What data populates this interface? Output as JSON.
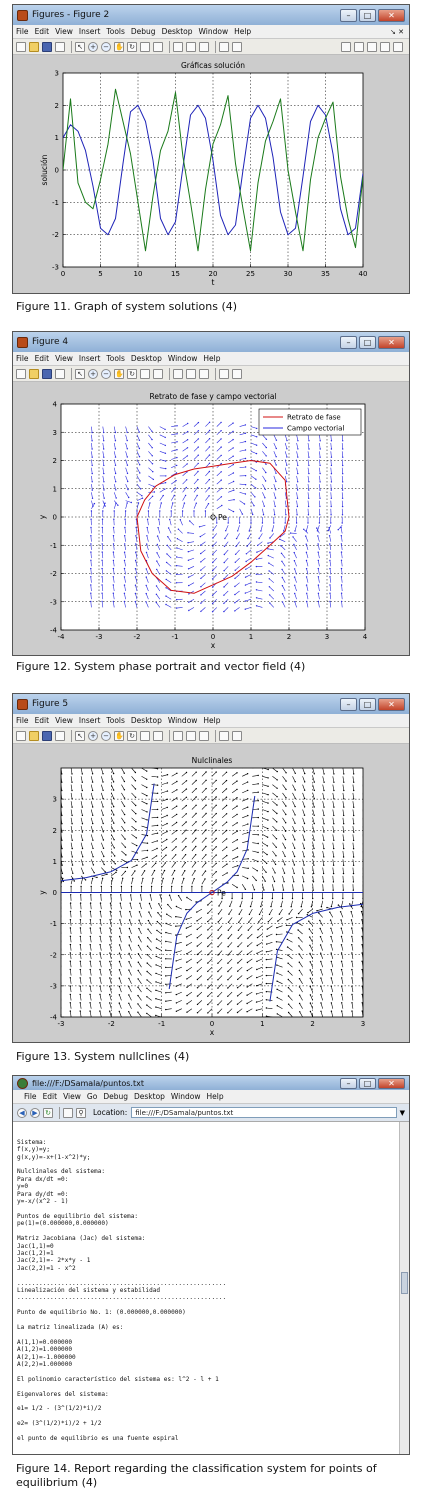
{
  "fig11": {
    "window_title": "Figures - Figure 2",
    "menu": [
      "File",
      "Edit",
      "View",
      "Insert",
      "Tools",
      "Debug",
      "Desktop",
      "Window",
      "Help"
    ],
    "menu_right": "↘ ✕",
    "caption": "Figure 11. Graph of system solutions (4)",
    "chart_data": {
      "type": "line",
      "title": "Gráficas solución",
      "xlabel": "t",
      "ylabel": "solución",
      "xlim": [
        0,
        40
      ],
      "ylim": [
        -3,
        3
      ],
      "xticks": [
        "0",
        "5",
        "10",
        "15",
        "20",
        "25",
        "30",
        "35",
        "40"
      ],
      "yticks": [
        "-3",
        "-2",
        "-1",
        "0",
        "1",
        "2",
        "3"
      ],
      "grid": true,
      "series": [
        {
          "color": "#1f24b8",
          "x": [
            0,
            1,
            2,
            3,
            4,
            5,
            6,
            7,
            8,
            9,
            10,
            11,
            12,
            13,
            14,
            15,
            16,
            17,
            18,
            19,
            20,
            21,
            22,
            23,
            24,
            25,
            26,
            27,
            28,
            29,
            30,
            31,
            32,
            33,
            34,
            35,
            36,
            37,
            38,
            39,
            40
          ],
          "y": [
            1,
            1.4,
            1.2,
            0.6,
            -0.5,
            -1.8,
            -2.0,
            -1.5,
            0.2,
            1.8,
            2.0,
            1.5,
            0.3,
            -1.5,
            -2.0,
            -1.6,
            0.1,
            1.7,
            2.0,
            1.6,
            0.3,
            -1.4,
            -2.0,
            -1.7,
            0.0,
            1.6,
            2.0,
            1.6,
            0.4,
            -1.3,
            -2.0,
            -1.8,
            -0.2,
            1.5,
            2.0,
            1.7,
            0.5,
            -1.2,
            -2.0,
            -1.8,
            -0.1
          ]
        },
        {
          "color": "#1a7a1a",
          "x": [
            0,
            1,
            2,
            3,
            4,
            5,
            6,
            7,
            8,
            9,
            10,
            11,
            12,
            13,
            14,
            15,
            16,
            17,
            18,
            19,
            20,
            21,
            22,
            23,
            24,
            25,
            26,
            27,
            28,
            29,
            30,
            31,
            32,
            33,
            34,
            35,
            36,
            37,
            38,
            39,
            40
          ],
          "y": [
            0,
            2.2,
            -0.4,
            -1.0,
            -1.2,
            -0.3,
            0.8,
            2.5,
            1.5,
            0.5,
            -1.0,
            -2.5,
            -0.8,
            0.6,
            1.2,
            2.4,
            0.4,
            -1.0,
            -2.5,
            -0.6,
            0.8,
            1.4,
            2.3,
            0.2,
            -1.2,
            -2.5,
            -0.4,
            0.9,
            1.5,
            2.2,
            0.0,
            -1.3,
            -2.5,
            -0.3,
            1.0,
            1.6,
            2.1,
            -0.2,
            -1.5,
            -2.4,
            -0.2
          ]
        }
      ]
    }
  },
  "fig12": {
    "window_title": "Figure 4",
    "menu": [
      "File",
      "Edit",
      "View",
      "Insert",
      "Tools",
      "Desktop",
      "Window",
      "Help"
    ],
    "caption": "Figure 12. System phase portrait and vector field (4)",
    "chart_data": {
      "type": "line",
      "title": "Retrato de fase y campo vectorial",
      "xlabel": "x",
      "ylabel": "y",
      "xlim": [
        -4,
        4
      ],
      "ylim": [
        -4,
        4
      ],
      "xticks": [
        "-4",
        "-3",
        "-2",
        "-1",
        "0",
        "1",
        "2",
        "3",
        "4"
      ],
      "yticks": [
        "-4",
        "-3",
        "-2",
        "-1",
        "0",
        "1",
        "2",
        "3",
        "4"
      ],
      "grid": true,
      "legend": [
        "Retrato de fase",
        "Campo vectorial"
      ],
      "legend_position": "top-right",
      "annotation": "Pe",
      "equilibrium": [
        0,
        0
      ],
      "series": [
        {
          "name": "Retrato de fase",
          "color": "#d01010",
          "x": [
            2.0,
            1.9,
            1.5,
            1.0,
            0.5,
            0.0,
            -0.5,
            -1.0,
            -1.5,
            -1.8,
            -2.0,
            -1.9,
            -1.6,
            -1.1,
            -0.5,
            0.0,
            0.5,
            1.0,
            1.5,
            1.9,
            2.0
          ],
          "y": [
            0.0,
            1.3,
            1.9,
            2.0,
            1.9,
            1.8,
            1.7,
            1.5,
            1.1,
            0.6,
            0.0,
            -1.2,
            -2.0,
            -2.6,
            -2.7,
            -2.4,
            -2.1,
            -1.6,
            -1.0,
            -0.5,
            0.0
          ]
        }
      ]
    }
  },
  "fig13": {
    "window_title": "Figure 5",
    "menu": [
      "File",
      "Edit",
      "View",
      "Insert",
      "Tools",
      "Desktop",
      "Window",
      "Help"
    ],
    "caption": "Figure 13. System nullclines (4)",
    "chart_data": {
      "type": "line",
      "title": "Nulclinales",
      "xlabel": "x",
      "ylabel": "y",
      "xlim": [
        -3,
        3
      ],
      "ylim": [
        -4,
        4
      ],
      "xticks": [
        "-3",
        "-2",
        "-1",
        "0",
        "1",
        "2",
        "3"
      ],
      "yticks": [
        "-4",
        "-3",
        "-2",
        "-1",
        "0",
        "1",
        "2",
        "3"
      ],
      "grid": true,
      "annotation": "Pe",
      "equilibrium": [
        0,
        0
      ],
      "series": [
        {
          "color": "#1a2ab0",
          "x": [
            -3,
            3
          ],
          "y": [
            0,
            0
          ]
        },
        {
          "color": "#1a2ab0",
          "x": [
            -3.0,
            -2.5,
            -2.0,
            -1.6,
            -1.3,
            -1.15
          ],
          "y": [
            0.38,
            0.48,
            0.67,
            1.03,
            1.88,
            3.5
          ]
        },
        {
          "color": "#1a2ab0",
          "x": [
            -0.85,
            -0.7,
            -0.5,
            -0.3,
            0.0,
            0.3,
            0.5,
            0.7,
            0.85
          ],
          "y": [
            -3.1,
            -1.4,
            -0.67,
            -0.33,
            0.0,
            0.33,
            0.67,
            1.4,
            3.1
          ]
        },
        {
          "color": "#1a2ab0",
          "x": [
            1.15,
            1.3,
            1.6,
            2.0,
            2.5,
            3.0
          ],
          "y": [
            -3.5,
            -1.88,
            -1.03,
            -0.67,
            -0.48,
            -0.38
          ]
        }
      ]
    }
  },
  "fig14": {
    "window_title": "file:///F:/DSamala/puntos.txt",
    "menu": [
      "File",
      "Edit",
      "View",
      "Go",
      "Debug",
      "Desktop",
      "Window",
      "Help"
    ],
    "location_label": "Location:",
    "location_value": "file:///F:/DSamala/puntos.txt",
    "caption": "Figure 14. Report regarding the classification system for points of equilibrium (4)",
    "report_text": "Sistema:\nf(x,y)=y;\ng(x,y)=-x+(1-x^2)*y;\n\nNulclinales del sistema:\nPara dx/dt =0:\ny=0\nPara dy/dt =0:\ny=-x/(x^2 - 1)\n\nPuntos de equilibrio del sistema:\npe(1)=(0.000000,0.000000)\n\nMatriz Jacobiana (Jac) del sistema:\nJac(1,1)=0\nJac(1,2)=1\nJac(2,1)=- 2*x*y - 1\nJac(2,2)=1 - x^2\n\n.........................................................\nLinealización del sistema y estabilidad\n.........................................................\n\nPunto de equilibrio No. 1: (0.000000,0.000000)\n\nLa matriz linealizada (A) es:\n\nA(1,1)=0.000000\nA(1,2)=1.000000\nA(2,1)=-1.000000\nA(2,2)=1.000000\n\nEl polinomio característico del sistema es: l^2 - l + 1\n\nEigenvalores del sistema:\n\ne1= 1/2 - (3^(1/2)*i)/2\n\ne2= (3^(1/2)*i)/2 + 1/2\n\nel punto de equilibrio es una fuente espiral"
  }
}
